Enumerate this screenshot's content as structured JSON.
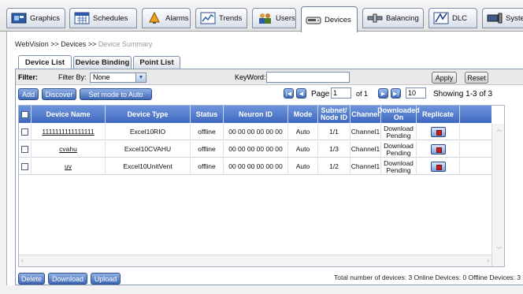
{
  "nav_tabs": [
    {
      "label": "Graphics",
      "icon": "graphics-icon"
    },
    {
      "label": "Schedules",
      "icon": "schedules-icon"
    },
    {
      "label": "Alarms",
      "icon": "alarms-icon"
    },
    {
      "label": "Trends",
      "icon": "trends-icon"
    },
    {
      "label": "Users",
      "icon": "users-icon"
    },
    {
      "label": "Devices",
      "icon": "devices-icon",
      "active": true
    },
    {
      "label": "Balancing",
      "icon": "balancing-icon"
    },
    {
      "label": "DLC",
      "icon": "dlc-icon"
    },
    {
      "label": "System",
      "icon": "system-icon"
    }
  ],
  "breadcrumb": {
    "root": "WebVision",
    "sep1": ">>",
    "devices": "Devices",
    "sep2": ">>",
    "current": "Device Summary"
  },
  "sub_tabs": [
    {
      "label": "Device List",
      "active": true
    },
    {
      "label": "Device Binding"
    },
    {
      "label": "Point List"
    }
  ],
  "filter": {
    "label": "Filter:",
    "filter_by_label": "Filter By:",
    "filter_by_value": "None",
    "keyword_label": "KeyWord:",
    "keyword_value": "",
    "apply": "Apply",
    "reset": "Reset"
  },
  "toolbar": {
    "add": "Add",
    "discover": "Discover",
    "set_mode": "Set mode to Auto",
    "page_label": "Page",
    "page_value": "1",
    "of_label": "of 1",
    "page_size": "10",
    "showing": "Showing 1-3 of 3"
  },
  "table": {
    "columns": [
      "Device Name",
      "Device Type",
      "Status",
      "Neuron ID",
      "Mode",
      "Subnet/ Node ID",
      "Channel",
      "Downloaded On",
      "Replicate"
    ],
    "rows": [
      {
        "name": "1111111111111111",
        "type": "Excel10RIO",
        "status": "offline",
        "neuron": "00 00 00 00 00 00",
        "mode": "Auto",
        "node": "1/1",
        "channel": "Channel1",
        "downloaded": "Download Pending"
      },
      {
        "name": "cvahu",
        "type": "Excel10CVAHU",
        "status": "offline",
        "neuron": "00 00 00 00 00 00",
        "mode": "Auto",
        "node": "1/3",
        "channel": "Channel1",
        "downloaded": "Download Pending"
      },
      {
        "name": "uv",
        "type": "Excel10UnitVent",
        "status": "offline",
        "neuron": "00 00 00 00 00 00",
        "mode": "Auto",
        "node": "1/2",
        "channel": "Channel1",
        "downloaded": "Download Pending"
      }
    ]
  },
  "bottom": {
    "delete": "Delete",
    "download": "Download",
    "upload": "Upload",
    "summary": "Total number of devices: 3 Online Devices: 0 Offline Devices: 3"
  },
  "colors": {
    "header_blue": "#4a74c9",
    "accent_blue": "#3f68b4"
  }
}
